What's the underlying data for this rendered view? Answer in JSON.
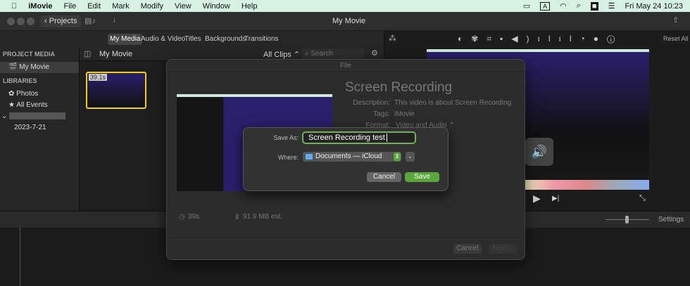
{
  "menubar": {
    "app": "iMovie",
    "items": [
      "File",
      "Edit",
      "Mark",
      "Modify",
      "View",
      "Window",
      "Help"
    ],
    "datetime": "Fri May 24  10:23",
    "input_source": "A"
  },
  "toolbar": {
    "projects": "Projects",
    "title": "My Movie"
  },
  "tabs": [
    "My Media",
    "Audio & Video",
    "Titles",
    "Backgrounds",
    "Transitions"
  ],
  "sidebar": {
    "project_media": "PROJECT MEDIA",
    "project": "My Movie",
    "libraries": "LIBRARIES",
    "photos": "Photos",
    "all_events": "All Events",
    "event_date": "2023-7-21"
  },
  "browser": {
    "title": "My Movie",
    "filter": "All Clips ⌃",
    "search_placeholder": "Search",
    "clip_duration": "39.1s"
  },
  "viewer": {
    "reset_all": "Reset All"
  },
  "timeline": {
    "settings": "Settings"
  },
  "export": {
    "header": "File",
    "title": "Screen Recording",
    "description_label": "Description:",
    "description": "This video is about Screen Recording",
    "tags_label": "Tags:",
    "tags": "iMovie",
    "format_label": "Format:",
    "format": "Video and Audio ⌃",
    "duration": "39s",
    "size": "91.9 MB est.",
    "cancel": "Cancel",
    "next": "Next..."
  },
  "save_dialog": {
    "save_as_label": "Save As:",
    "save_as_value": "Screen Recording test",
    "where_label": "Where:",
    "where_value": "Documents — iCloud",
    "cancel": "Cancel",
    "save": "Save"
  },
  "colors": {
    "accent_green": "#5aa83c",
    "clip_selection": "#f5d100",
    "menubar": "#d5f2e3"
  }
}
